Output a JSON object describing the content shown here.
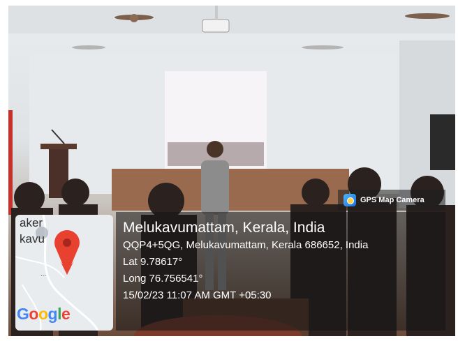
{
  "badge": {
    "label": "GPS Map Camera",
    "icon": "gps-map-camera-icon"
  },
  "location": {
    "place": "Melukavumattam, Kerala, India",
    "address": "QQP4+5QG, Melukavumattam, Kerala 686652, India",
    "lat": "Lat 9.78617°",
    "long": "Long 76.756541°",
    "datetime": "15/02/23 11:07 AM GMT +05:30"
  },
  "map": {
    "labels": [
      "aker",
      "kavu"
    ],
    "provider": "Google",
    "pin_color": "#e8412f"
  }
}
